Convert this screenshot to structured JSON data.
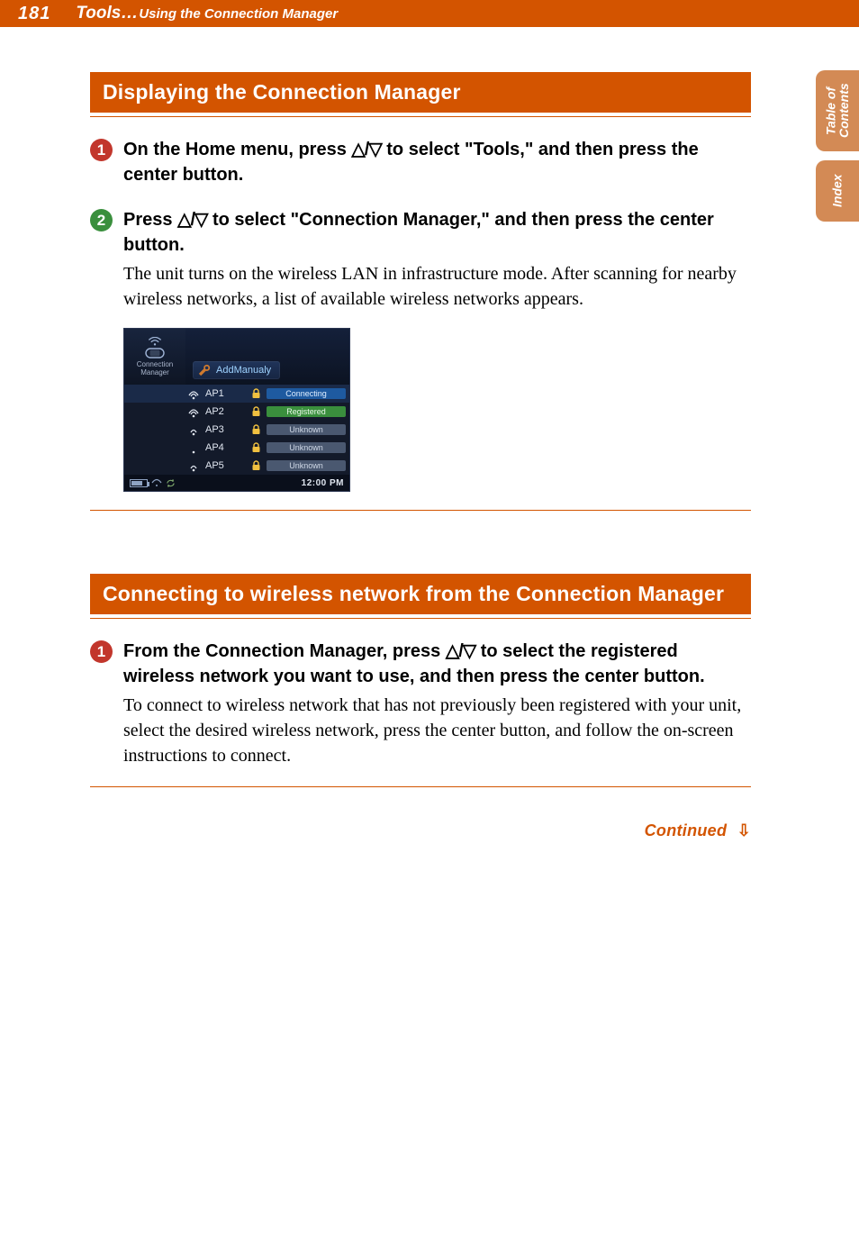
{
  "header": {
    "page_number": "181",
    "crumb_main": "Tools",
    "crumb_dots": "…",
    "crumb_sub": "Using the Connection Manager"
  },
  "side_tabs": {
    "toc": "Table of\nContents",
    "index": "Index"
  },
  "section1": {
    "heading": "Displaying the Connection Manager",
    "step1_num": "1",
    "step1_head_a": "On the Home menu, press ",
    "step1_head_tri": "△/▽",
    "step1_head_b": " to select \"Tools,\" and then press the center button.",
    "step2_num": "2",
    "step2_head_a": "Press ",
    "step2_head_tri": "△/▽",
    "step2_head_b": " to select \"Connection Manager,\" and then press the center button.",
    "step2_body": "The unit turns on the wireless LAN in infrastructure mode. After scanning for nearby wireless networks, a list of available wireless networks appears."
  },
  "device": {
    "sidebar_label": "Connection\nManager",
    "add_manually": "AddManualy",
    "rows": [
      {
        "name": "AP1",
        "status": "Connecting",
        "status_class": "connecting",
        "sig": 3
      },
      {
        "name": "AP2",
        "status": "Registered",
        "status_class": "registered",
        "sig": 3
      },
      {
        "name": "AP3",
        "status": "Unknown",
        "status_class": "unknown",
        "sig": 2
      },
      {
        "name": "AP4",
        "status": "Unknown",
        "status_class": "unknown",
        "sig": 1
      },
      {
        "name": "AP5",
        "status": "Unknown",
        "status_class": "unknown",
        "sig": 2
      }
    ],
    "clock": "12:00 PM"
  },
  "section2": {
    "heading": "Connecting to wireless network from the Connection Manager",
    "step1_num": "1",
    "step1_head_a": "From the Connection Manager, press ",
    "step1_head_tri": "△/▽",
    "step1_head_b": " to select the registered wireless network you want to use, and then press the center button.",
    "step1_body": "To connect to wireless network that has not previously been registered with your unit, select the desired wireless network, press the center button, and follow the on-screen instructions to connect."
  },
  "continued": {
    "label": "Continued",
    "arrow": "⇩"
  }
}
